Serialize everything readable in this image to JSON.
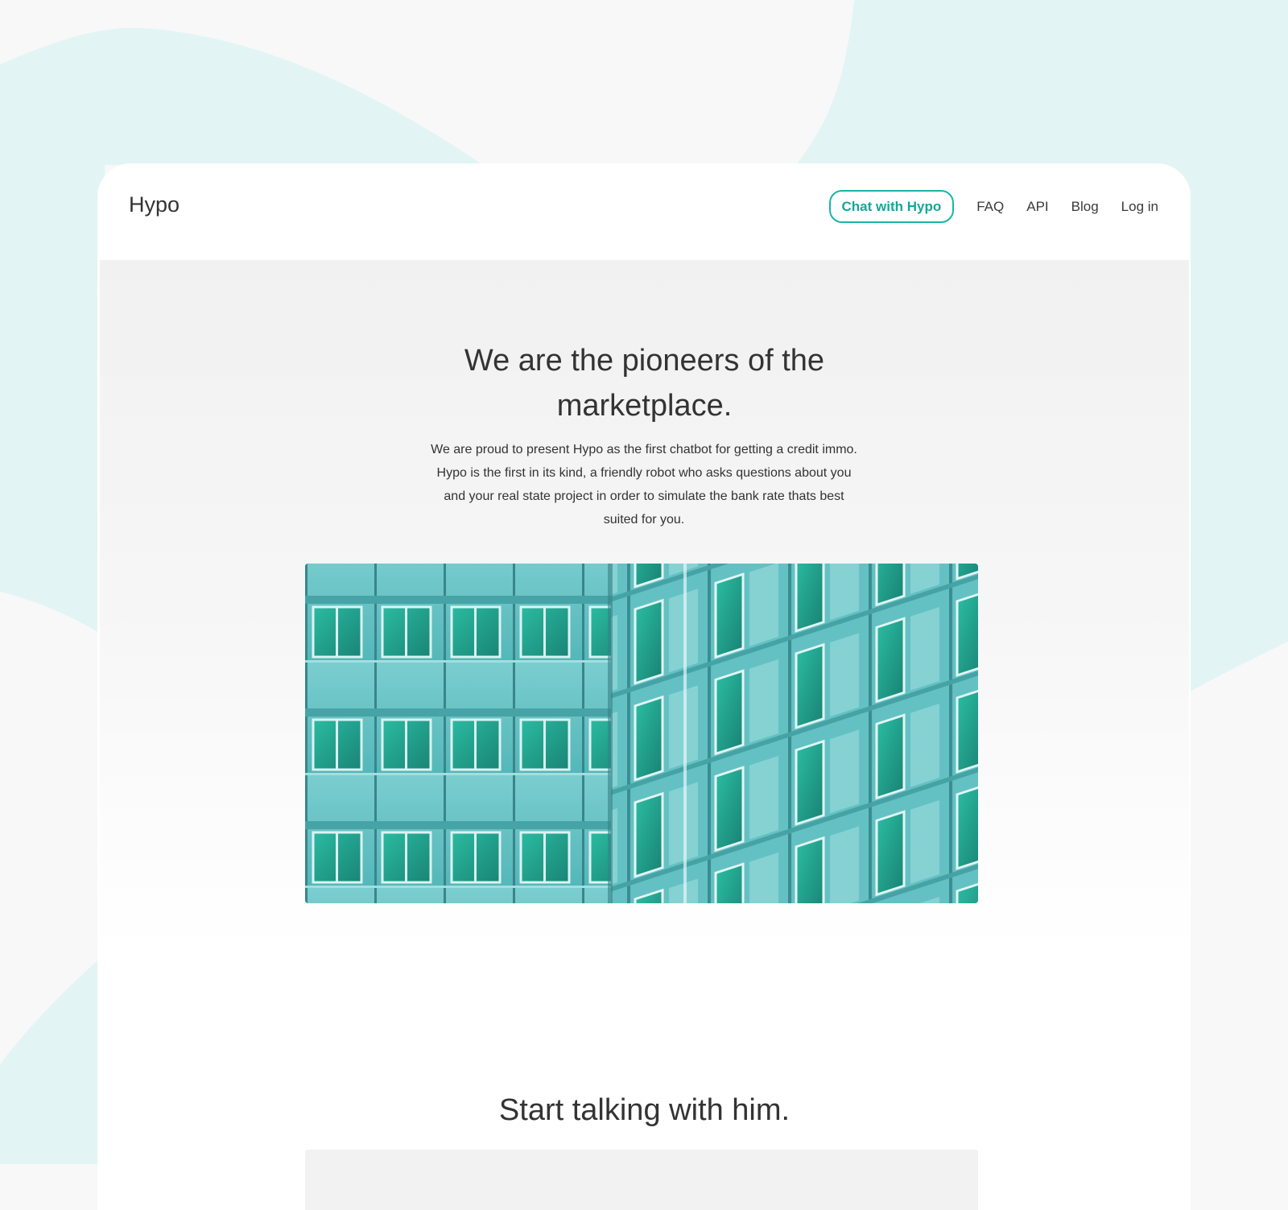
{
  "brand": {
    "logo_text": "Hypo"
  },
  "nav": {
    "cta_label": "Chat with Hypo",
    "links": [
      "FAQ",
      "API",
      "Blog",
      "Log in"
    ]
  },
  "hero": {
    "title_line1": "We are the pioneers of the",
    "title_line2": "marketplace.",
    "text_lines": [
      "We are proud to present Hypo as the first chatbot for getting a credit immo.",
      "Hypo is the first in its kind, a friendly robot who asks questions about you",
      "and your real state project in order to simulate the bank rate thats best",
      "suited for you."
    ],
    "image": "teal-building-facade-photo"
  },
  "section": {
    "title": "Start talking with him."
  },
  "colors": {
    "accent": "#19b5a5",
    "accent_text": "#12a898",
    "background": "#f8f8f8",
    "blob": "#e2f5f4",
    "panel": "#ffffff",
    "text": "#333333"
  }
}
